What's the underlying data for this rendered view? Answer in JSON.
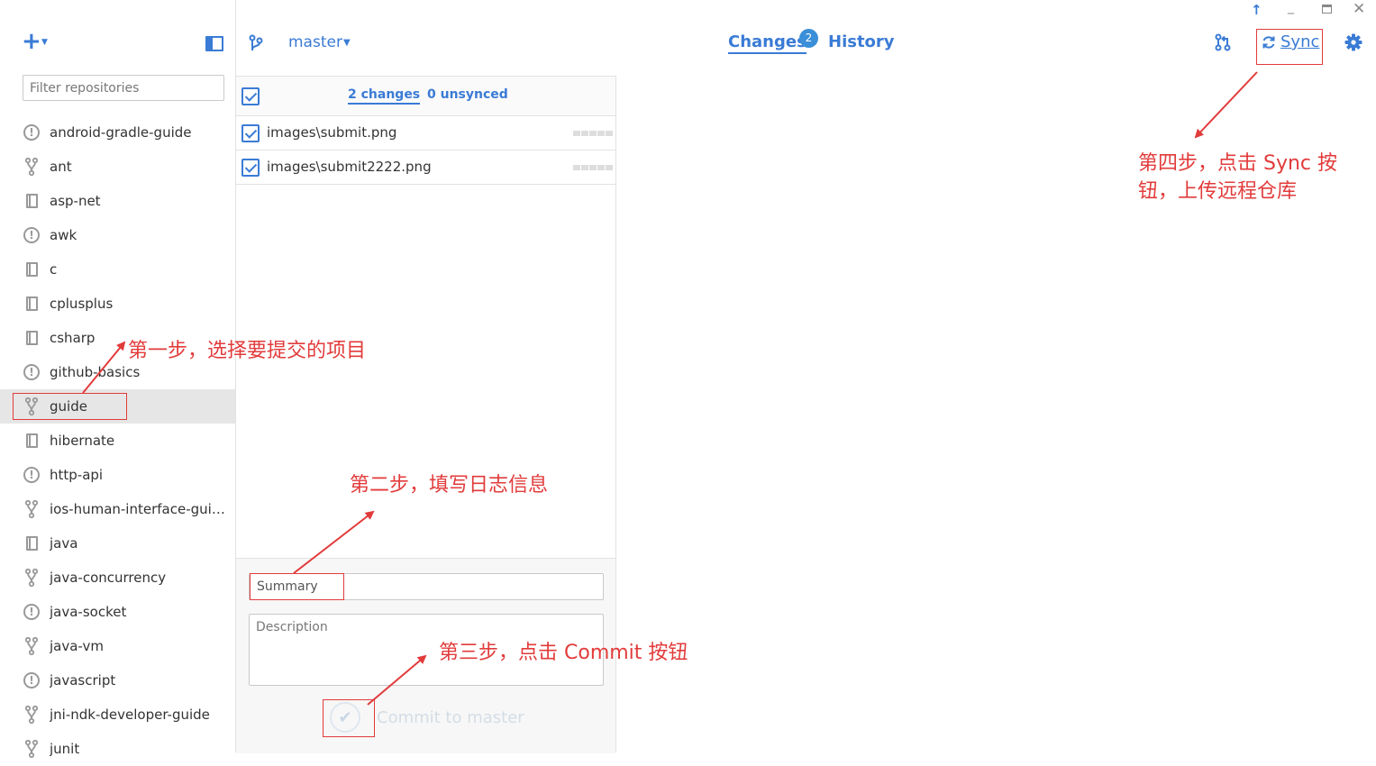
{
  "sidebar": {
    "add_icon": "plus-icon",
    "toggle_icon": "panel-toggle-icon",
    "filter_placeholder": "Filter repositories",
    "repositories": [
      {
        "name": "android-gradle-guide",
        "icon": "warning-icon"
      },
      {
        "name": "ant",
        "icon": "fork-icon"
      },
      {
        "name": "asp-net",
        "icon": "book-icon"
      },
      {
        "name": "awk",
        "icon": "warning-icon"
      },
      {
        "name": "c",
        "icon": "book-icon"
      },
      {
        "name": "cplusplus",
        "icon": "book-icon"
      },
      {
        "name": "csharp",
        "icon": "book-icon"
      },
      {
        "name": "github-basics",
        "icon": "warning-icon"
      },
      {
        "name": "guide",
        "icon": "fork-icon",
        "selected": true
      },
      {
        "name": "hibernate",
        "icon": "book-icon"
      },
      {
        "name": "http-api",
        "icon": "warning-icon"
      },
      {
        "name": "ios-human-interface-guid...",
        "icon": "fork-icon"
      },
      {
        "name": "java",
        "icon": "book-icon"
      },
      {
        "name": "java-concurrency",
        "icon": "fork-icon"
      },
      {
        "name": "java-socket",
        "icon": "warning-icon"
      },
      {
        "name": "java-vm",
        "icon": "fork-icon"
      },
      {
        "name": "javascript",
        "icon": "warning-icon"
      },
      {
        "name": "jni-ndk-developer-guide",
        "icon": "fork-icon"
      },
      {
        "name": "junit",
        "icon": "fork-icon"
      }
    ]
  },
  "header": {
    "branch": "master",
    "tabs": {
      "changes": "Changes",
      "changes_badge": "2",
      "history": "History"
    },
    "sync_label": "Sync"
  },
  "changes": {
    "count_label": "2 changes",
    "unsynced_label": "0 unsynced",
    "files": [
      {
        "path": "images\\submit.png"
      },
      {
        "path": "images\\submit2222.png"
      }
    ],
    "summary_placeholder": "Summary",
    "description_placeholder": "Description",
    "commit_label": "Commit to master"
  },
  "annotations": {
    "step1": "第一步，选择要提交的项目",
    "step2": "第二步，填写日志信息",
    "step3": "第三步，点击 Commit 按钮",
    "step4_line1": "第四步，点击 Sync 按",
    "step4_line2": "钮，上传远程仓库"
  },
  "colors": {
    "accent": "#3a7bd5",
    "annotation": "#e23b3b",
    "selected_row": "#e6e6e6"
  }
}
